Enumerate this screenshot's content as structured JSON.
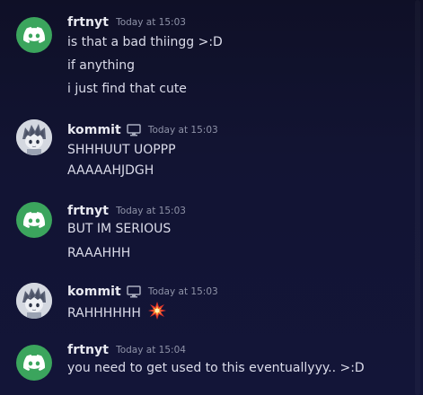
{
  "colors": {
    "background": "#0f1027",
    "discord_green": "#3ba55d",
    "text": "#dbdcea",
    "timestamp": "#8f93a8"
  },
  "messages": [
    {
      "username": "frtnyt",
      "avatar": "discord-logo-icon",
      "timestamp": "Today at 15:03",
      "lines": [
        "is that a bad thiingg >:D",
        "if anything",
        "i just find that cute"
      ]
    },
    {
      "username": "kommit",
      "avatar": "anime-character-avatar",
      "device_icon": "desktop-icon",
      "timestamp": "Today at 15:03",
      "lines": [
        "SHHHUUT UOPPP",
        "AAAAAHJDGH"
      ]
    },
    {
      "username": "frtnyt",
      "avatar": "discord-logo-icon",
      "timestamp": "Today at 15:03",
      "lines": [
        "BUT IM SERIOUS",
        "RAAAHHH"
      ]
    },
    {
      "username": "kommit",
      "avatar": "anime-character-avatar",
      "device_icon": "desktop-icon",
      "timestamp": "Today at 15:03",
      "lines": [
        "RAHHHHHH"
      ],
      "emoji": "collision-emoji-icon"
    },
    {
      "username": "frtnyt",
      "avatar": "discord-logo-icon",
      "timestamp": "Today at 15:04",
      "lines": [
        "you need to get used to this eventuallyyy.. >:D"
      ]
    }
  ]
}
